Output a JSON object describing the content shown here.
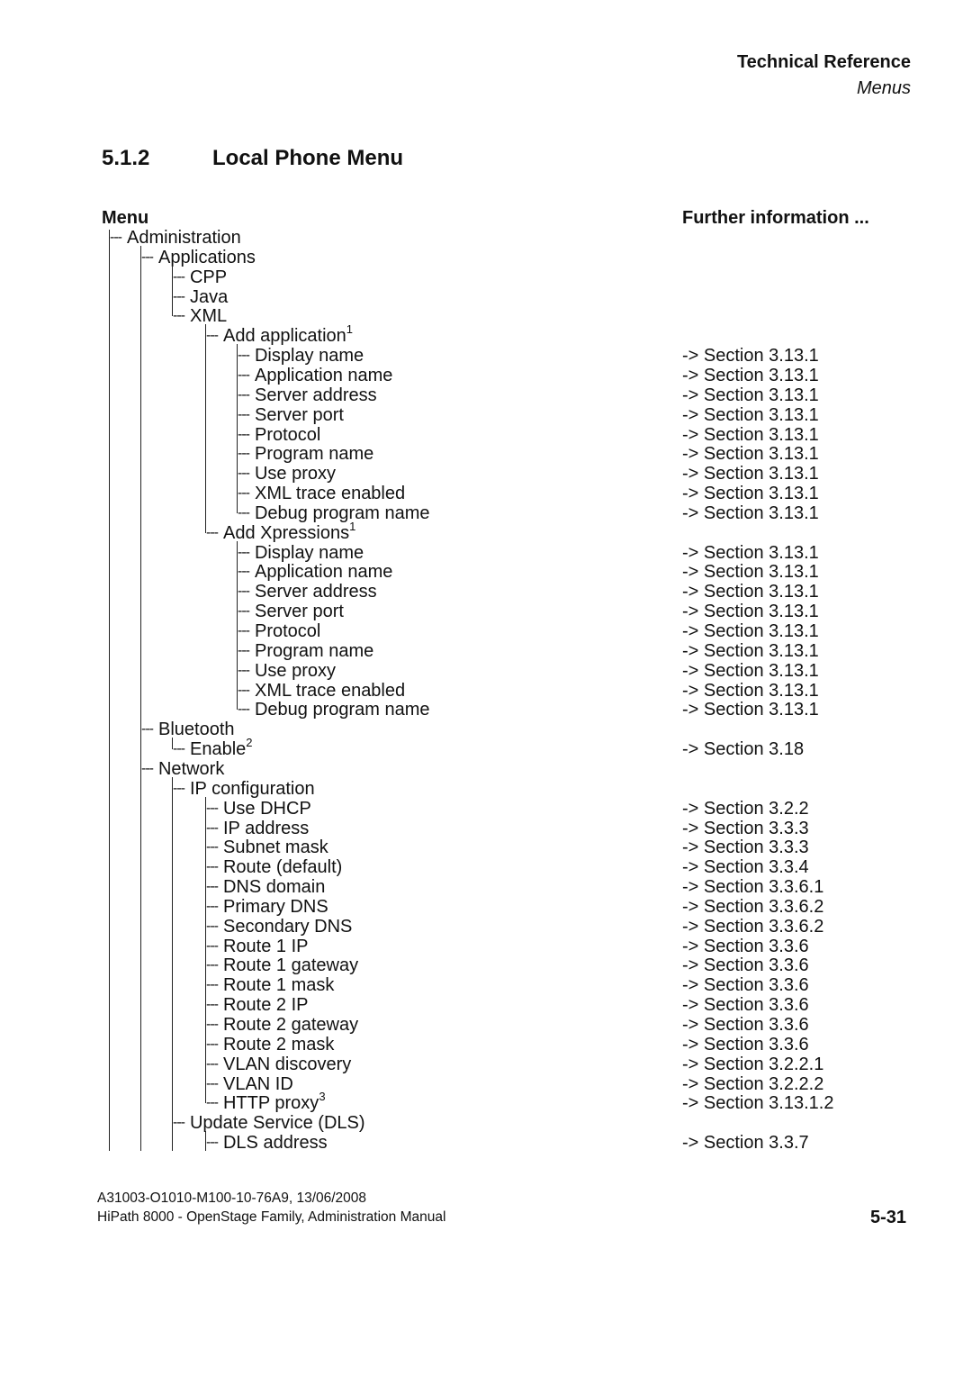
{
  "header": {
    "title": "Technical Reference",
    "subtitle": "Menus"
  },
  "section": {
    "number": "5.1.2",
    "title": "Local Phone Menu"
  },
  "columns": {
    "menu": "Menu",
    "info": "Further information ..."
  },
  "tree": [
    {
      "level": 1,
      "label": "Administration",
      "ref": ""
    },
    {
      "level": 2,
      "label": "Applications",
      "ref": ""
    },
    {
      "level": 3,
      "label": "CPP",
      "ref": ""
    },
    {
      "level": 3,
      "label": "Java",
      "ref": ""
    },
    {
      "level": 3,
      "label": "XML",
      "ref": ""
    },
    {
      "level": 4,
      "label": "Add application",
      "sup": "1",
      "ref": ""
    },
    {
      "level": 5,
      "label": "Display name",
      "ref": "-> Section 3.13.1"
    },
    {
      "level": 5,
      "label": "Application name",
      "ref": "-> Section 3.13.1"
    },
    {
      "level": 5,
      "label": "Server address",
      "ref": "-> Section 3.13.1"
    },
    {
      "level": 5,
      "label": "Server port",
      "ref": "-> Section 3.13.1"
    },
    {
      "level": 5,
      "label": "Protocol",
      "ref": "-> Section 3.13.1"
    },
    {
      "level": 5,
      "label": "Program name",
      "ref": "-> Section 3.13.1"
    },
    {
      "level": 5,
      "label": "Use proxy",
      "ref": "-> Section 3.13.1"
    },
    {
      "level": 5,
      "label": "XML trace enabled",
      "ref": "-> Section 3.13.1"
    },
    {
      "level": 5,
      "label": "Debug program name",
      "ref": "-> Section 3.13.1"
    },
    {
      "level": 4,
      "label": "Add Xpressions",
      "sup": "1",
      "ref": ""
    },
    {
      "level": 5,
      "label": "Display name",
      "ref": "-> Section 3.13.1"
    },
    {
      "level": 5,
      "label": "Application name",
      "ref": "-> Section 3.13.1"
    },
    {
      "level": 5,
      "label": "Server address",
      "ref": "-> Section 3.13.1"
    },
    {
      "level": 5,
      "label": "Server port",
      "ref": "-> Section 3.13.1"
    },
    {
      "level": 5,
      "label": "Protocol",
      "ref": "-> Section 3.13.1"
    },
    {
      "level": 5,
      "label": "Program name",
      "ref": "-> Section 3.13.1"
    },
    {
      "level": 5,
      "label": "Use proxy",
      "ref": "-> Section 3.13.1"
    },
    {
      "level": 5,
      "label": "XML trace enabled",
      "ref": "-> Section 3.13.1"
    },
    {
      "level": 5,
      "label": "Debug program name",
      "ref": "-> Section 3.13.1"
    },
    {
      "level": 2,
      "label": "Bluetooth",
      "ref": ""
    },
    {
      "level": 3,
      "label": "Enable",
      "sup": "2",
      "ref": "-> Section 3.18"
    },
    {
      "level": 2,
      "label": "Network",
      "ref": ""
    },
    {
      "level": 3,
      "label": "IP configuration",
      "ref": ""
    },
    {
      "level": 4,
      "label": "Use DHCP",
      "ref": "-> Section 3.2.2"
    },
    {
      "level": 4,
      "label": "IP address",
      "ref": "-> Section 3.3.3"
    },
    {
      "level": 4,
      "label": "Subnet mask",
      "ref": "-> Section 3.3.3"
    },
    {
      "level": 4,
      "label": "Route (default)",
      "ref": "-> Section 3.3.4"
    },
    {
      "level": 4,
      "label": "DNS domain",
      "ref": "-> Section 3.3.6.1"
    },
    {
      "level": 4,
      "label": "Primary DNS",
      "ref": "-> Section 3.3.6.2"
    },
    {
      "level": 4,
      "label": "Secondary DNS",
      "ref": "-> Section 3.3.6.2"
    },
    {
      "level": 4,
      "label": "Route 1 IP",
      "ref": "-> Section 3.3.6"
    },
    {
      "level": 4,
      "label": "Route 1 gateway",
      "ref": "-> Section 3.3.6"
    },
    {
      "level": 4,
      "label": "Route 1 mask",
      "ref": "-> Section 3.3.6"
    },
    {
      "level": 4,
      "label": "Route 2 IP",
      "ref": "-> Section 3.3.6"
    },
    {
      "level": 4,
      "label": "Route 2 gateway",
      "ref": "-> Section 3.3.6"
    },
    {
      "level": 4,
      "label": "Route 2 mask",
      "ref": "-> Section 3.3.6"
    },
    {
      "level": 4,
      "label": "VLAN discovery",
      "ref": "-> Section 3.2.2.1"
    },
    {
      "level": 4,
      "label": "VLAN ID",
      "ref": "-> Section 3.2.2.2"
    },
    {
      "level": 4,
      "label": "HTTP proxy",
      "sup": "3",
      "ref": "-> Section 3.13.1.2"
    },
    {
      "level": 3,
      "label": "Update Service (DLS)",
      "ref": ""
    },
    {
      "level": 4,
      "label": "DLS address",
      "ref": "-> Section 3.3.7"
    }
  ],
  "footer": {
    "doc_id": "A31003-O1010-M100-10-76A9, 13/06/2008",
    "manual": "HiPath 8000 - OpenStage Family, Administration Manual",
    "page": "5-31"
  }
}
